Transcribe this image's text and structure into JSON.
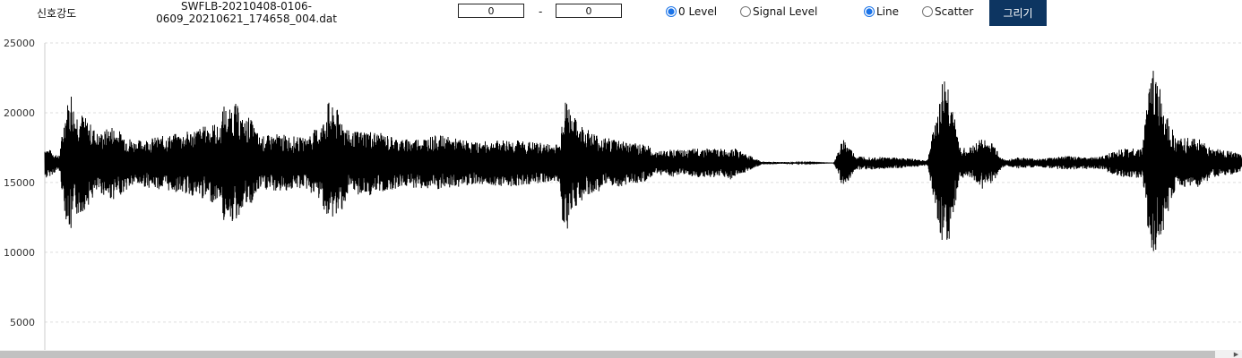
{
  "controls": {
    "signal_label": "신호강도",
    "file_name": "SWFLB-20210408-0106-0609_20210621_174658_004.dat",
    "range_start": "0",
    "range_separator": "-",
    "range_end": "0",
    "level_options": [
      {
        "label": "0 Level",
        "checked": true
      },
      {
        "label": "Signal Level",
        "checked": false
      }
    ],
    "plot_options": [
      {
        "label": "Line",
        "checked": true
      },
      {
        "label": "Scatter",
        "checked": false
      }
    ],
    "draw_button_label": "그리기",
    "scroll_icon": "chevron-right-icon"
  },
  "chart_data": {
    "type": "line",
    "title": "",
    "xlabel": "",
    "ylabel": "",
    "ylim": [
      3000,
      25000
    ],
    "yticks": [
      5000,
      10000,
      15000,
      20000,
      25000
    ],
    "grid": true,
    "line_color": "#000000",
    "grid_color": "#dddddd",
    "baseline": 16400,
    "series": [
      {
        "x": [
          0,
          16,
          23,
          30,
          33,
          38,
          45,
          60,
          75,
          100,
          155,
          190,
          195,
          200,
          205,
          208,
          212,
          216,
          222,
          228,
          240,
          260,
          290,
          310,
          316,
          320,
          324,
          330,
          340,
          360,
          400,
          440,
          480,
          520,
          560,
          575,
          578,
          580,
          583,
          588,
          596,
          610,
          625,
          640,
          655,
          670,
          680,
          700,
          715,
          730,
          760,
          765,
          800,
          880,
          887,
          890,
          905,
          950,
          985,
          1003,
          1008,
          1011,
          1014,
          1020,
          1030,
          1047,
          1050,
          1058,
          1063,
          1067,
          1073,
          1085,
          1110,
          1140,
          1175,
          1200,
          1225,
          1230,
          1237,
          1240,
          1243,
          1247,
          1252,
          1262,
          1290,
          1300,
          1320,
          1336
        ],
        "y": [
          17600,
          16900,
          20300,
          11000,
          20100,
          12500,
          19700,
          14300,
          19100,
          14800,
          18600,
          19300,
          14000,
          20800,
          12900,
          20600,
          12000,
          20400,
          13400,
          19800,
          14500,
          18500,
          14600,
          19300,
          11900,
          20400,
          12400,
          20000,
          14200,
          18800,
          14700,
          18400,
          14900,
          18100,
          15000,
          17800,
          11800,
          20700,
          11600,
          19900,
          13500,
          18700,
          14600,
          18200,
          15000,
          17900,
          15600,
          17400,
          15500,
          17500,
          15400,
          17600,
          16300,
          16400,
          17400,
          14500,
          16900,
          16000,
          16600,
          22700,
          10500,
          21200,
          12400,
          17700,
          15400,
          18300,
          14800,
          17800,
          15300,
          16800,
          16200,
          16800,
          16100,
          16900,
          16000,
          17400,
          15300,
          21000,
          9400,
          23200,
          11000,
          21600,
          12600,
          18200,
          14600,
          17500,
          15500,
          17000
        ]
      }
    ]
  }
}
